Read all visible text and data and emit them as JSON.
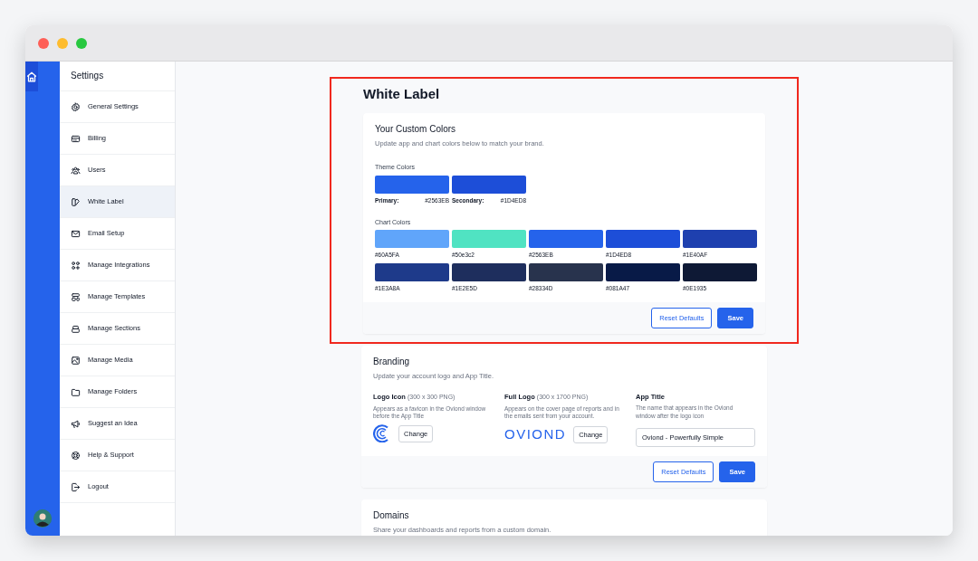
{
  "rail": {
    "items": [
      {
        "selected": true
      }
    ]
  },
  "sidebar": {
    "title": "Settings",
    "items": [
      {
        "label": "General Settings",
        "selected": false
      },
      {
        "label": "Billing",
        "selected": false
      },
      {
        "label": "Users",
        "selected": false
      },
      {
        "label": "White Label",
        "selected": true
      },
      {
        "label": "Email Setup",
        "selected": false
      },
      {
        "label": "Manage Integrations",
        "selected": false
      },
      {
        "label": "Manage Templates",
        "selected": false
      },
      {
        "label": "Manage Sections",
        "selected": false
      },
      {
        "label": "Manage Media",
        "selected": false
      },
      {
        "label": "Manage Folders",
        "selected": false
      },
      {
        "label": "Suggest an Idea",
        "selected": false
      },
      {
        "label": "Help & Support",
        "selected": false
      },
      {
        "label": "Logout",
        "selected": false
      }
    ]
  },
  "page": {
    "title": "White Label",
    "highlighted": true
  },
  "custom_colors": {
    "title": "Your Custom Colors",
    "subtitle": "Update app and chart colors below to match your brand.",
    "theme_label": "Theme Colors",
    "theme_colors": [
      {
        "name": "Primary:",
        "value": "#2563EB",
        "color": "#2563eb"
      },
      {
        "name": "Secondary:",
        "value": "#1D4ED8",
        "color": "#1d4ed8"
      }
    ],
    "chart_label": "Chart Colors",
    "chart_colors": [
      {
        "value": "#60A5FA",
        "color": "#60a5fa"
      },
      {
        "value": "#50e3c2",
        "color": "#50e3c2"
      },
      {
        "value": "#2563EB",
        "color": "#2563eb"
      },
      {
        "value": "#1D4ED8",
        "color": "#1d4ed8"
      },
      {
        "value": "#1E40AF",
        "color": "#1e40af"
      },
      {
        "value": "#1E3A8A",
        "color": "#1e3a8a"
      },
      {
        "value": "#1E2E5D",
        "color": "#1e2e5d"
      },
      {
        "value": "#28334D",
        "color": "#28334d"
      },
      {
        "value": "#081A47",
        "color": "#081a47"
      },
      {
        "value": "#0E1935",
        "color": "#0e1935"
      }
    ],
    "buttons": [
      "Reset Defaults",
      "Save"
    ]
  },
  "branding": {
    "title": "Branding",
    "subtitle": "Update your account logo and App Title.",
    "logo_icon": {
      "label": "Logo Icon",
      "hint": "(300 x 300 PNG)",
      "description": "Appears as a favicon in the Oviond window before the App Title",
      "button": "Change"
    },
    "full_logo": {
      "label": "Full Logo",
      "hint": "(300 x 1700 PNG)",
      "description": "Appears on the cover page of reports and in the emails sent from your account.",
      "logo_text": "OVIOND",
      "button": "Change"
    },
    "app_title": {
      "label": "App Title",
      "description": "The name that appears in the Oviond window after the logo icon",
      "value": "Oviond - Powerfully Simple"
    },
    "buttons": [
      "Reset Defaults",
      "Save"
    ]
  },
  "domains": {
    "title": "Domains",
    "subtitle": "Share your dashboards and reports from a custom domain."
  }
}
